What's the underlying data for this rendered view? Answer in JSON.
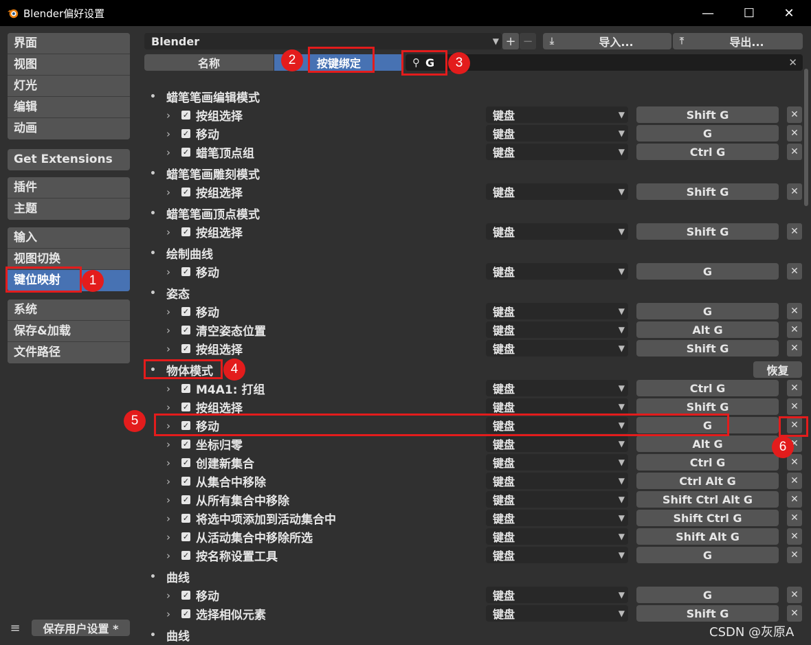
{
  "window": {
    "title": "Blender偏好设置",
    "min": "—",
    "max": "☐",
    "close": "✕"
  },
  "sidebar": {
    "groups": [
      [
        "界面",
        "视图",
        "灯光",
        "编辑",
        "动画"
      ],
      [
        "Get Extensions"
      ],
      [
        "插件",
        "主题"
      ],
      [
        "输入",
        "视图切换",
        "键位映射"
      ],
      [
        "系统",
        "保存&加载",
        "文件路径"
      ]
    ],
    "active": "键位映射",
    "save_label": "保存用户设置 *",
    "menu_icon": "≡"
  },
  "header": {
    "preset": "Blender",
    "add": "+",
    "remove": "−",
    "import_label": "导入...",
    "export_label": "导出...",
    "tab_name": "名称",
    "tab_key": "按键绑定",
    "search_value": "G",
    "clear": "✕"
  },
  "keymap": [
    {
      "type": "cat",
      "label": "蜡笔笔画编辑模式"
    },
    {
      "type": "item",
      "label": "按组选择",
      "device": "键盘",
      "key": "Shift G"
    },
    {
      "type": "item",
      "label": "移动",
      "device": "键盘",
      "key": "G"
    },
    {
      "type": "item",
      "label": "蜡笔顶点组",
      "device": "键盘",
      "key": "Ctrl G"
    },
    {
      "type": "cat",
      "label": "蜡笔笔画雕刻模式"
    },
    {
      "type": "item",
      "label": "按组选择",
      "device": "键盘",
      "key": "Shift G"
    },
    {
      "type": "cat",
      "label": "蜡笔笔画顶点模式"
    },
    {
      "type": "item",
      "label": "按组选择",
      "device": "键盘",
      "key": "Shift G"
    },
    {
      "type": "cat",
      "label": "绘制曲线"
    },
    {
      "type": "item",
      "label": "移动",
      "device": "键盘",
      "key": "G"
    },
    {
      "type": "cat",
      "label": "姿态"
    },
    {
      "type": "item",
      "label": "移动",
      "device": "键盘",
      "key": "G"
    },
    {
      "type": "item",
      "label": "清空姿态位置",
      "device": "键盘",
      "key": "Alt G"
    },
    {
      "type": "item",
      "label": "按组选择",
      "device": "键盘",
      "key": "Shift G"
    },
    {
      "type": "cat",
      "label": "物体模式",
      "restore": "恢复"
    },
    {
      "type": "item",
      "label": "M4A1: 打组",
      "device": "键盘",
      "key": "Ctrl G"
    },
    {
      "type": "item",
      "label": "按组选择",
      "device": "键盘",
      "key": "Shift G"
    },
    {
      "type": "item",
      "label": "移动",
      "device": "键盘",
      "key": "G"
    },
    {
      "type": "item",
      "label": "坐标归零",
      "device": "键盘",
      "key": "Alt G"
    },
    {
      "type": "item",
      "label": "创建新集合",
      "device": "键盘",
      "key": "Ctrl G"
    },
    {
      "type": "item",
      "label": "从集合中移除",
      "device": "键盘",
      "key": "Ctrl Alt G"
    },
    {
      "type": "item",
      "label": "从所有集合中移除",
      "device": "键盘",
      "key": "Shift Ctrl Alt G"
    },
    {
      "type": "item",
      "label": "将选中项添加到活动集合中",
      "device": "键盘",
      "key": "Shift Ctrl G"
    },
    {
      "type": "item",
      "label": "从活动集合中移除所选",
      "device": "键盘",
      "key": "Shift Alt G"
    },
    {
      "type": "item",
      "label": "按名称设置工具",
      "device": "键盘",
      "key": "G"
    },
    {
      "type": "cat",
      "label": "曲线"
    },
    {
      "type": "item",
      "label": "移动",
      "device": "键盘",
      "key": "G"
    },
    {
      "type": "item",
      "label": "选择相似元素",
      "device": "键盘",
      "key": "Shift G"
    },
    {
      "type": "cat",
      "label": "曲线"
    }
  ],
  "annotations": [
    "1",
    "2",
    "3",
    "4",
    "5",
    "6"
  ],
  "watermark": "CSDN @灰原A",
  "colors": {
    "accent": "#4772b3",
    "annotation": "#e31c1c",
    "panel": "#545454",
    "background": "#303030"
  }
}
